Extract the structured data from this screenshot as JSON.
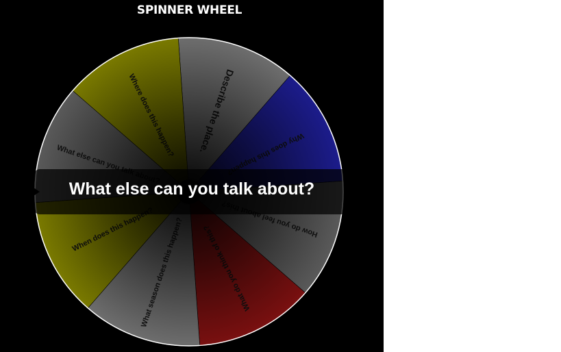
{
  "app": {
    "title": "SPINNER WHEEL"
  },
  "wheel": {
    "segments": [
      {
        "label": "Describe the place.",
        "color": "#6e6e6e"
      },
      {
        "label": "Why does this happen?",
        "color": "#1c1c8c"
      },
      {
        "label": "How do you feel about this?",
        "color": "#5a5a5a"
      },
      {
        "label": "What do you think of this?",
        "color": "#7a1010"
      },
      {
        "label": "What season does this happen?",
        "color": "#6e6e6e"
      },
      {
        "label": "When does this happen?",
        "color": "#7a7a00"
      },
      {
        "label": "What else can you talk about?",
        "color": "#5a5a5a"
      },
      {
        "label": "Where does this happen?",
        "color": "#7a7a00"
      }
    ],
    "pointer_icon": "triangle-pointer-icon",
    "hub_icon": "center-hub-icon"
  },
  "result": {
    "text": "What else can you talk about?"
  },
  "colors": {
    "background": "#000000",
    "rim": "#ffffff",
    "title": "#ffffff"
  }
}
